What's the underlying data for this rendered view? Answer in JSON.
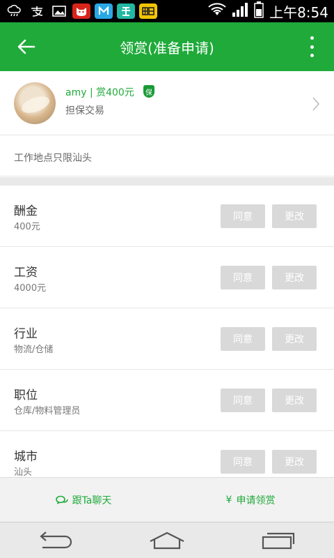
{
  "status_bar": {
    "left_icons": [
      "cloud-weather-icon",
      "alipay-icon",
      "gallery-icon",
      "tmall-icon",
      "meitu-icon",
      "meituan-icon",
      "tiantian-icon"
    ],
    "time": "上午8:54"
  },
  "header": {
    "title": "领赏(准备申请)"
  },
  "profile": {
    "name_line": "amy | 赏400元",
    "badge": "保",
    "subtitle": "担保交易"
  },
  "note": "工作地点只限汕头",
  "rows": [
    {
      "label": "酬金",
      "value": "400元"
    },
    {
      "label": "工资",
      "value": "4000元"
    },
    {
      "label": "行业",
      "value": "物流/仓储"
    },
    {
      "label": "职位",
      "value": "仓库/物料管理员"
    },
    {
      "label": "城市",
      "value": "汕头"
    }
  ],
  "buttons": {
    "agree": "同意",
    "change": "更改"
  },
  "actions": {
    "chat": "跟Ta聊天",
    "apply": "申请领赏",
    "apply_icon_symbol": "¥"
  },
  "colors": {
    "brand": "#1faa3a",
    "button_disabled": "#d9d9d9"
  }
}
